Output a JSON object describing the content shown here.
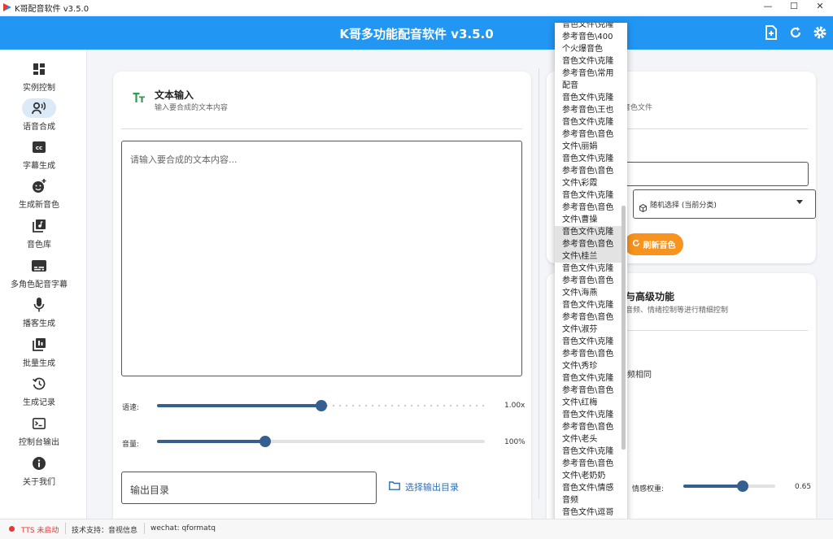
{
  "window": {
    "title": "K哥配音软件 v3.5.0"
  },
  "header": {
    "title": "K哥多功能配音软件 v3.5.0"
  },
  "sidebar": {
    "items": [
      {
        "label": "实例控制",
        "icon": "dashboard-icon"
      },
      {
        "label": "语音合成",
        "icon": "voice-icon"
      },
      {
        "label": "字幕生成",
        "icon": "cc-icon"
      },
      {
        "label": "生成新音色",
        "icon": "emoji-plus-icon"
      },
      {
        "label": "音色库",
        "icon": "library-icon"
      },
      {
        "label": "多角色配音字幕",
        "icon": "subtitles-icon"
      },
      {
        "label": "播客生成",
        "icon": "mic-icon"
      },
      {
        "label": "批量生成",
        "icon": "batch-icon"
      },
      {
        "label": "生成记录",
        "icon": "history-icon"
      },
      {
        "label": "控制台输出",
        "icon": "terminal-icon"
      },
      {
        "label": "关于我们",
        "icon": "info-icon"
      }
    ]
  },
  "text_input": {
    "title": "文本输入",
    "subtitle": "输入要合成的文本内容",
    "placeholder": "请输入要合成的文本内容..."
  },
  "speed": {
    "label": "语速:",
    "value": "1.00x",
    "fraction": 0.5
  },
  "volume": {
    "label": "音量:",
    "value": "100%",
    "fraction": 0.33
  },
  "output": {
    "placeholder": "输出目录",
    "choose_label": "选择输出目录"
  },
  "voice_card": {
    "subtitle_fragment": "音色文件",
    "select_value": "随机选择 (当前分类)",
    "refresh_label": "刷新音色"
  },
  "advanced_card": {
    "title_fragment": "与高级功能",
    "subtitle_fragment": "音频、情绪控制等进行精细控制",
    "option_fragment": "频相同",
    "emotion_label": "情感权重:",
    "emotion_value": "0.65",
    "emotion_fraction": 0.65
  },
  "dropdown": {
    "items": [
      "音色文件\\克隆",
      "参考音色\\400",
      "个火爆音色",
      "音色文件\\克隆",
      "参考音色\\常用",
      "配音",
      "音色文件\\克隆",
      "参考音色\\王也",
      "音色文件\\克隆",
      "参考音色\\音色",
      "文件\\丽娟",
      "音色文件\\克隆",
      "参考音色\\音色",
      "文件\\彩霞",
      "音色文件\\克隆",
      "参考音色\\音色",
      "文件\\曹操",
      "音色文件\\克隆",
      "参考音色\\音色",
      "文件\\桂兰",
      "音色文件\\克隆",
      "参考音色\\音色",
      "文件\\海燕",
      "音色文件\\克隆",
      "参考音色\\音色",
      "文件\\淑芬",
      "音色文件\\克隆",
      "参考音色\\音色",
      "文件\\秀珍",
      "音色文件\\克隆",
      "参考音色\\音色",
      "文件\\红梅",
      "音色文件\\克隆",
      "参考音色\\音色",
      "文件\\老头",
      "音色文件\\克隆",
      "参考音色\\音色",
      "文件\\老奶奶",
      "音色文件\\情感",
      "音频",
      "音色文件\\逗哥",
      "音色整理合集"
    ]
  },
  "status": {
    "tts_state": "TTS 未启动",
    "support": "技术支持：音视信息",
    "wechat": "wechat: qformatq"
  }
}
